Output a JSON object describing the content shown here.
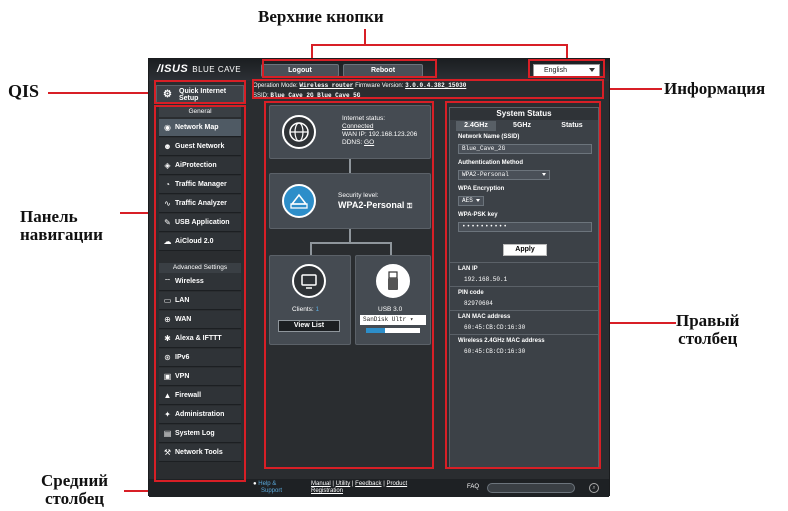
{
  "callouts": {
    "top_buttons": "Верхние кнопки",
    "qis": "QIS",
    "info": "Информация",
    "nav_panel_1": "Панель",
    "nav_panel_2": "навигации",
    "right_col_1": "Правый",
    "right_col_2": "столбец",
    "middle_col_1": "Средний",
    "middle_col_2": "столбец"
  },
  "colors": {
    "callout_line": "#d81f26",
    "accent_blue": "#2d8ec9",
    "panel_bg": "#2a2d30"
  },
  "header": {
    "logo": "/ISUS",
    "logo_model": "BLUE CAVE",
    "logout": "Logout",
    "reboot": "Reboot",
    "language": "English"
  },
  "info": {
    "op_mode_label": "Operation Mode:",
    "op_mode_value": "Wireless router",
    "firmware_label": "Firmware Version:",
    "firmware_value": "3.0.0.4.382_15030",
    "ssid_label": "SSID:",
    "ssid_value": "Blue_Cave_2G  Blue_Cave_5G"
  },
  "sidebar": {
    "qis_label_1": "Quick Internet",
    "qis_label_2": "Setup",
    "general_heading": "General",
    "general_items": [
      {
        "label": "Network Map",
        "icon": "network-map-icon"
      },
      {
        "label": "Guest Network",
        "icon": "guest-network-icon"
      },
      {
        "label": "AiProtection",
        "icon": "aiprotection-icon"
      },
      {
        "label": "Traffic Manager",
        "icon": "traffic-manager-icon"
      },
      {
        "label": "Traffic Analyzer",
        "icon": "traffic-analyzer-icon"
      },
      {
        "label": "USB Application",
        "icon": "usb-application-icon"
      },
      {
        "label": "AiCloud 2.0",
        "icon": "aicloud-icon"
      }
    ],
    "advanced_heading": "Advanced Settings",
    "advanced_items": [
      {
        "label": "Wireless",
        "icon": "wireless-icon"
      },
      {
        "label": "LAN",
        "icon": "lan-icon"
      },
      {
        "label": "WAN",
        "icon": "wan-icon"
      },
      {
        "label": "Alexa & IFTTT",
        "icon": "alexa-icon"
      },
      {
        "label": "IPv6",
        "icon": "ipv6-icon"
      },
      {
        "label": "VPN",
        "icon": "vpn-icon"
      },
      {
        "label": "Firewall",
        "icon": "firewall-icon"
      },
      {
        "label": "Administration",
        "icon": "administration-icon"
      },
      {
        "label": "System Log",
        "icon": "system-log-icon"
      },
      {
        "label": "Network Tools",
        "icon": "network-tools-icon"
      }
    ]
  },
  "middle": {
    "internet_status_label": "Internet status:",
    "internet_status_value": "Connected",
    "wan_ip": "WAN IP: 192.168.123.206",
    "ddns_label": "DDNS:",
    "ddns_value": "GO",
    "security_label": "Security level:",
    "security_value": "WPA2-Personal",
    "clients_label": "Clients:",
    "clients_value": "1",
    "view_list": "View List",
    "usb_label": "USB 3.0",
    "usb_device": "SanDisk Ultr",
    "usb_progress": 0.35
  },
  "system_status": {
    "title": "System Status",
    "tabs": [
      "2.4GHz",
      "5GHz",
      "Status"
    ],
    "ssid_label": "Network Name (SSID)",
    "ssid_value": "Blue_Cave_2G",
    "auth_label": "Authentication Method",
    "auth_value": "WPA2-Personal",
    "enc_label": "WPA Encryption",
    "enc_value": "AES",
    "psk_label": "WPA-PSK key",
    "psk_value": "••••••••••",
    "apply": "Apply",
    "lan_ip_label": "LAN IP",
    "lan_ip_value": "192.168.50.1",
    "pin_label": "PIN code",
    "pin_value": "82970604",
    "lan_mac_label": "LAN MAC address",
    "lan_mac_value": "60:45:CB:CD:16:30",
    "wl_mac_label": "Wireless 2.4GHz MAC address",
    "wl_mac_value": "60:45:CB:CD:16:30"
  },
  "footer": {
    "help_1": "Help &",
    "help_2": "Support",
    "manual": "Manual",
    "utility": "Utility",
    "feedback": "Feedback",
    "product": "Product",
    "registration": "Registration",
    "faq": "FAQ"
  }
}
